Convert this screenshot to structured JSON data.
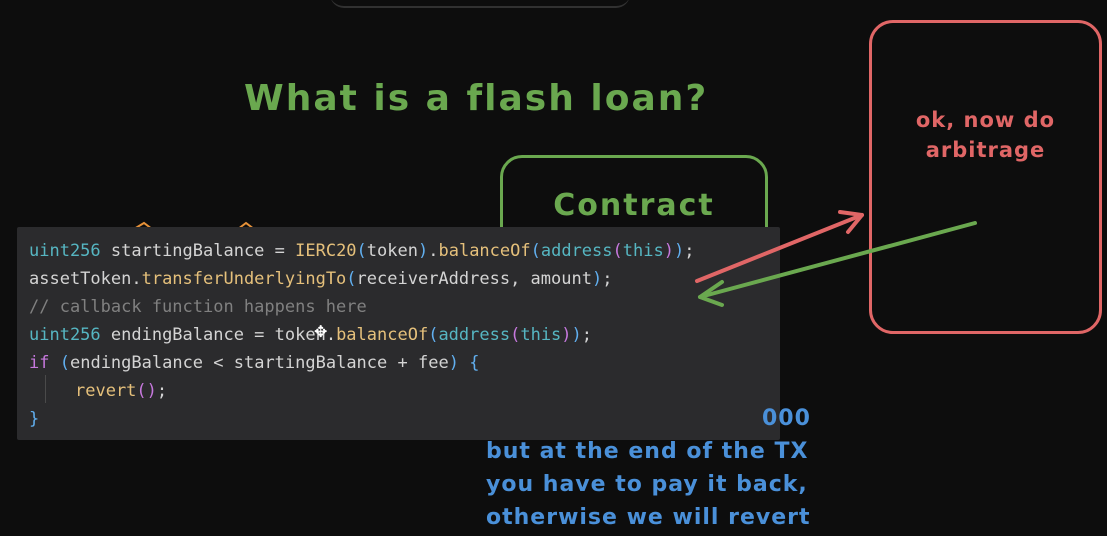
{
  "whiteboard": {
    "title": "What is a flash loan?",
    "contract_label": "Contract",
    "red_box_text_line1": "ok, now do",
    "red_box_text_line2": "arbitrage",
    "notes_partial": "000",
    "notes_line1": "but at the end of the TX",
    "notes_line2": "you have to pay it back,",
    "notes_line3": "otherwise we will revert"
  },
  "colors": {
    "background": "#0d0d0d",
    "green": "#6aa84f",
    "red": "#e06666",
    "blue": "#4a90d9",
    "code_panel": "#2b2b2d"
  },
  "code": {
    "lines": [
      "uint256 startingBalance = IERC20(token).balanceOf(address(this));",
      "assetToken.transferUnderlyingTo(receiverAddress, amount);",
      "// callback function happens here",
      "uint256 endingBalance = token.balanceOf(address(this));",
      "if (endingBalance < startingBalance + fee) {",
      "revert();",
      "}"
    ]
  },
  "icons": {
    "cursor": "move-cursor-icon"
  }
}
